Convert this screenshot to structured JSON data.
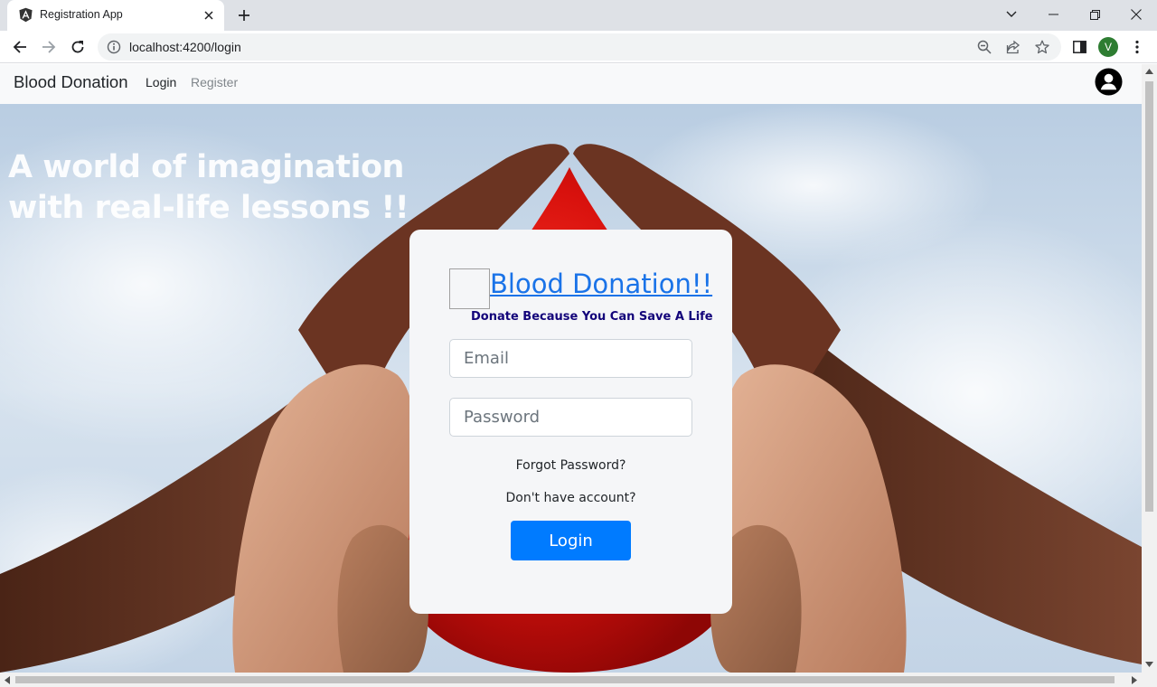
{
  "browser": {
    "tab_title": "Registration App",
    "url": "localhost:4200/login",
    "profile_initial": "V"
  },
  "navbar": {
    "brand": "Blood Donation",
    "links": [
      "Login",
      "Register"
    ]
  },
  "hero": {
    "tagline": "A world of imagination with real-life lessons !!"
  },
  "login_card": {
    "title": "Blood Donation!!",
    "subtitle": "Donate Because You Can Save A Life",
    "email_placeholder": "Email",
    "password_placeholder": "Password",
    "forgot_password": "Forgot Password?",
    "no_account": "Don't have account?",
    "login_button": "Login"
  }
}
